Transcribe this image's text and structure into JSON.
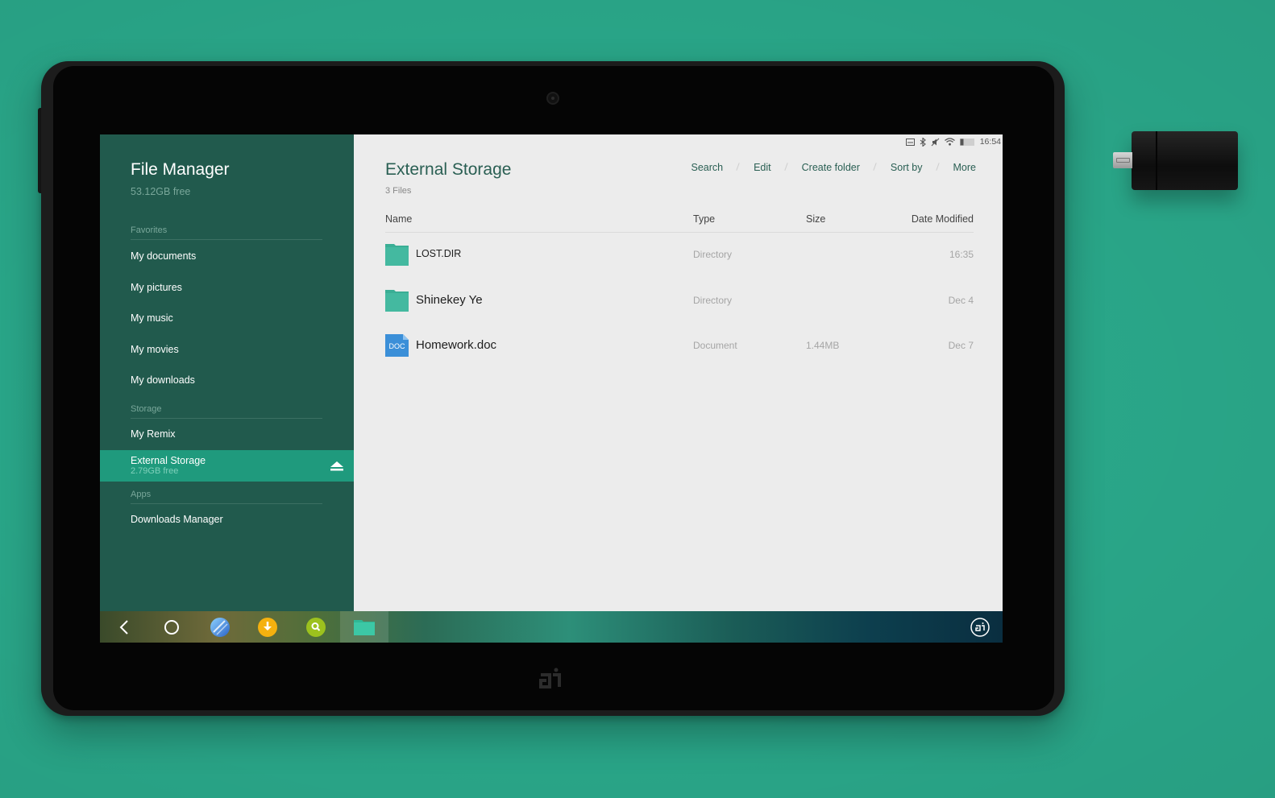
{
  "sidebar": {
    "title": "File Manager",
    "free_space": "53.12GB free",
    "sections": {
      "favorites": "Favorites",
      "storage": "Storage",
      "apps": "Apps"
    },
    "favorites": [
      "My documents",
      "My pictures",
      "My music",
      "My movies",
      "My downloads"
    ],
    "storage_items": {
      "my_remix": "My Remix",
      "external": {
        "label": "External Storage",
        "free": "2.79GB free"
      }
    },
    "apps_items": [
      "Downloads Manager"
    ]
  },
  "main": {
    "title": "External Storage",
    "file_count": "3 Files",
    "toolbar": {
      "search": "Search",
      "edit": "Edit",
      "create_folder": "Create folder",
      "sort_by": "Sort by",
      "more": "More"
    },
    "columns": {
      "name": "Name",
      "type": "Type",
      "size": "Size",
      "date": "Date Modified"
    },
    "files": [
      {
        "name": "LOST.DIR",
        "type": "Directory",
        "size": "",
        "date": "16:35",
        "icon": "folder-icon"
      },
      {
        "name": "Shinekey Ye",
        "type": "Directory",
        "size": "",
        "date": "Dec 4",
        "icon": "folder-icon"
      },
      {
        "name": "Homework.doc",
        "type": "Document",
        "size": "1.44MB",
        "date": "Dec 7",
        "icon": "doc-file-icon",
        "icon_label": "DOC"
      }
    ]
  },
  "status_bar": {
    "time": "16:54",
    "icons": [
      "screen-icon",
      "bluetooth-icon",
      "mute-icon",
      "wifi-icon",
      "battery-icon"
    ]
  },
  "taskbar": {
    "apps": [
      "back-icon",
      "home-icon",
      "browser-icon",
      "download-app-icon",
      "search-app-icon",
      "file-manager-icon"
    ],
    "right_icon": "remix-logo-icon"
  },
  "colors": {
    "background": "#2aa88a",
    "sidebar": "#215a4d",
    "sidebar_active": "#1f9a7d",
    "accent_text": "#2a5f53",
    "folder": "#3aae95",
    "doc": "#3b8fd8"
  }
}
